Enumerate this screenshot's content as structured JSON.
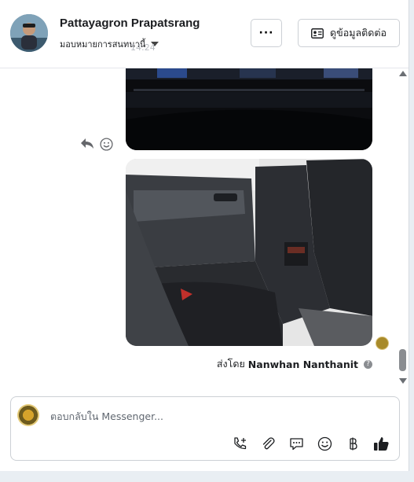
{
  "header": {
    "name": "Pattayagron Prapatsrang",
    "assign_label": "มอบหมายการสนทนานี้",
    "ghost_time": "14:24",
    "more_label": "···",
    "contact_button_label": "ดูข้อมูลติดต่อ"
  },
  "thread": {
    "sent_by_prefix": "ส่งโดย",
    "sent_by_name": "Nanwhan Nanthanit",
    "help_glyph": "?"
  },
  "composer": {
    "placeholder": "ตอบกลับใน Messenger..."
  },
  "icons": {
    "reply": "reply-icon",
    "react": "smile-icon",
    "call": "phone-add-icon",
    "attach": "paperclip-icon",
    "saved_replies": "chat-bubble-icon",
    "emoji": "emoji-icon",
    "payment": "baht-icon",
    "like": "thumbs-up-icon"
  },
  "colors": {
    "accent": "#1c1e21",
    "border": "#ccd0d5",
    "background": "#e9eef3"
  }
}
